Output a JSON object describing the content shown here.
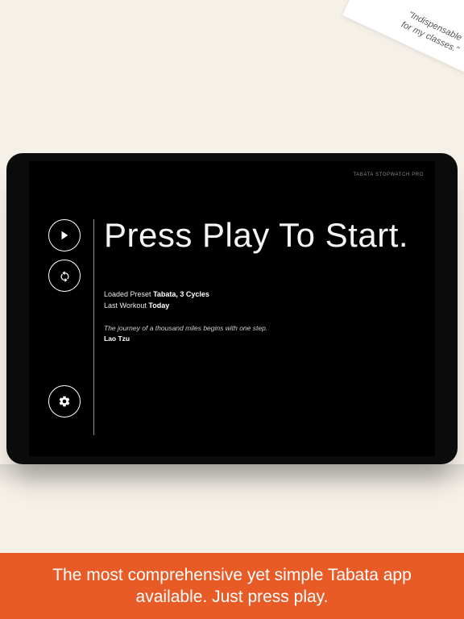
{
  "ribbon": {
    "line1": "\"Indispensable",
    "line2": "for my classes.\""
  },
  "app": {
    "brand": "TABATA STOPWATCH PRO",
    "heading": "Press Play To Start.",
    "preset_label": "Loaded Preset",
    "preset_value": "Tabata, 3 Cycles",
    "last_workout_label": "Last Workout",
    "last_workout_value": "Today",
    "quote_text": "The journey of a thousand miles begins with one step.",
    "quote_author": "Lao Tzu"
  },
  "caption": "The most comprehensive yet simple Tabata app available. Just press play."
}
